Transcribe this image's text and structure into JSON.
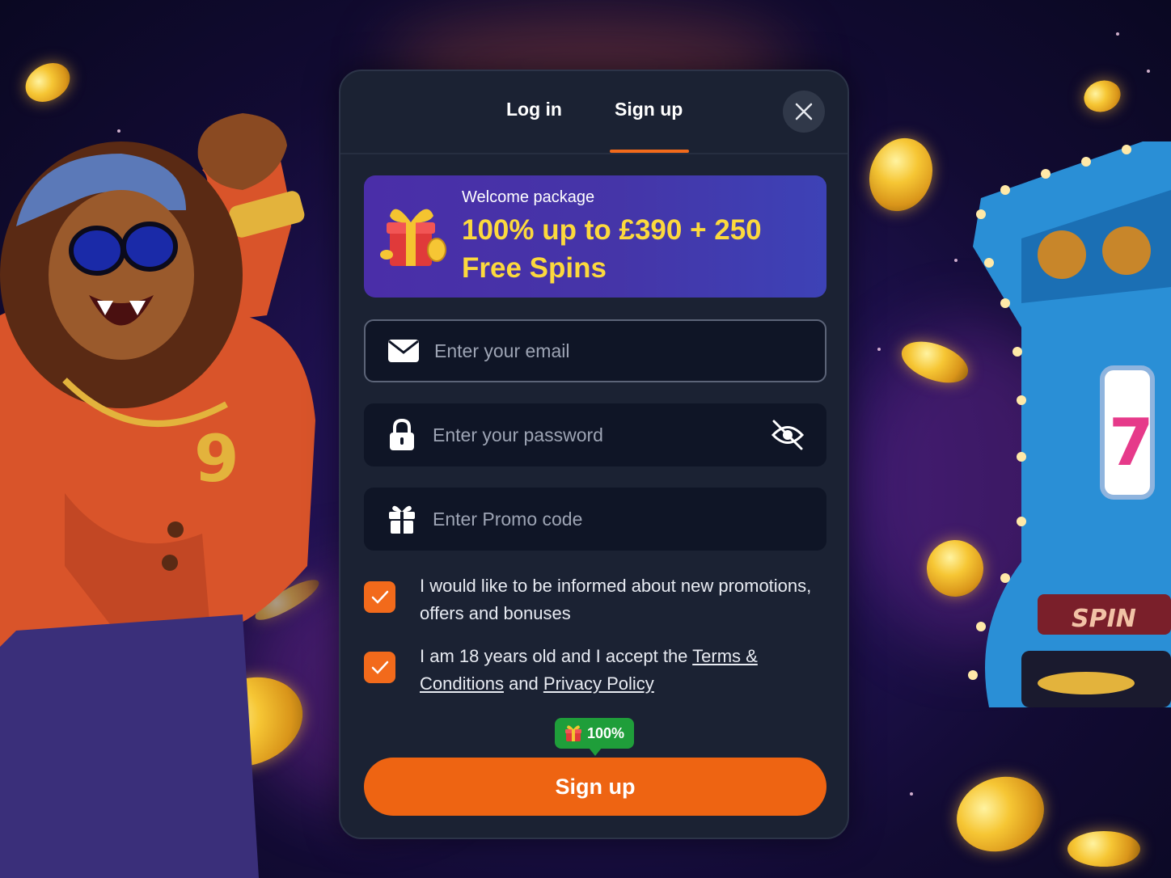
{
  "tabs": {
    "login": "Log in",
    "signup": "Sign up",
    "active": "signup"
  },
  "promo": {
    "subtitle": "Welcome package",
    "title": "100% up to £390 + 250 Free Spins"
  },
  "fields": {
    "email_placeholder": "Enter your email",
    "password_placeholder": "Enter your password",
    "promo_placeholder": "Enter Promo code"
  },
  "checkboxes": {
    "newsletter": {
      "label": "I would like to be informed about new promotions, offers and bonuses",
      "checked": true
    },
    "terms": {
      "prefix": "I am 18 years old and I accept the ",
      "terms_link": "Terms & Conditions",
      "middle": " and ",
      "privacy_link": "Privacy Policy",
      "checked": true
    }
  },
  "badge": {
    "text": "100%",
    "icon": "gift-icon"
  },
  "signup_button": "Sign up",
  "colors": {
    "accent": "#ee6412",
    "promo_text": "#fcd93d",
    "badge_green": "#1f9e3a",
    "modal_bg": "#1b2233"
  },
  "background": {
    "slot_label": "SPIN",
    "slot_symbol": "7"
  }
}
